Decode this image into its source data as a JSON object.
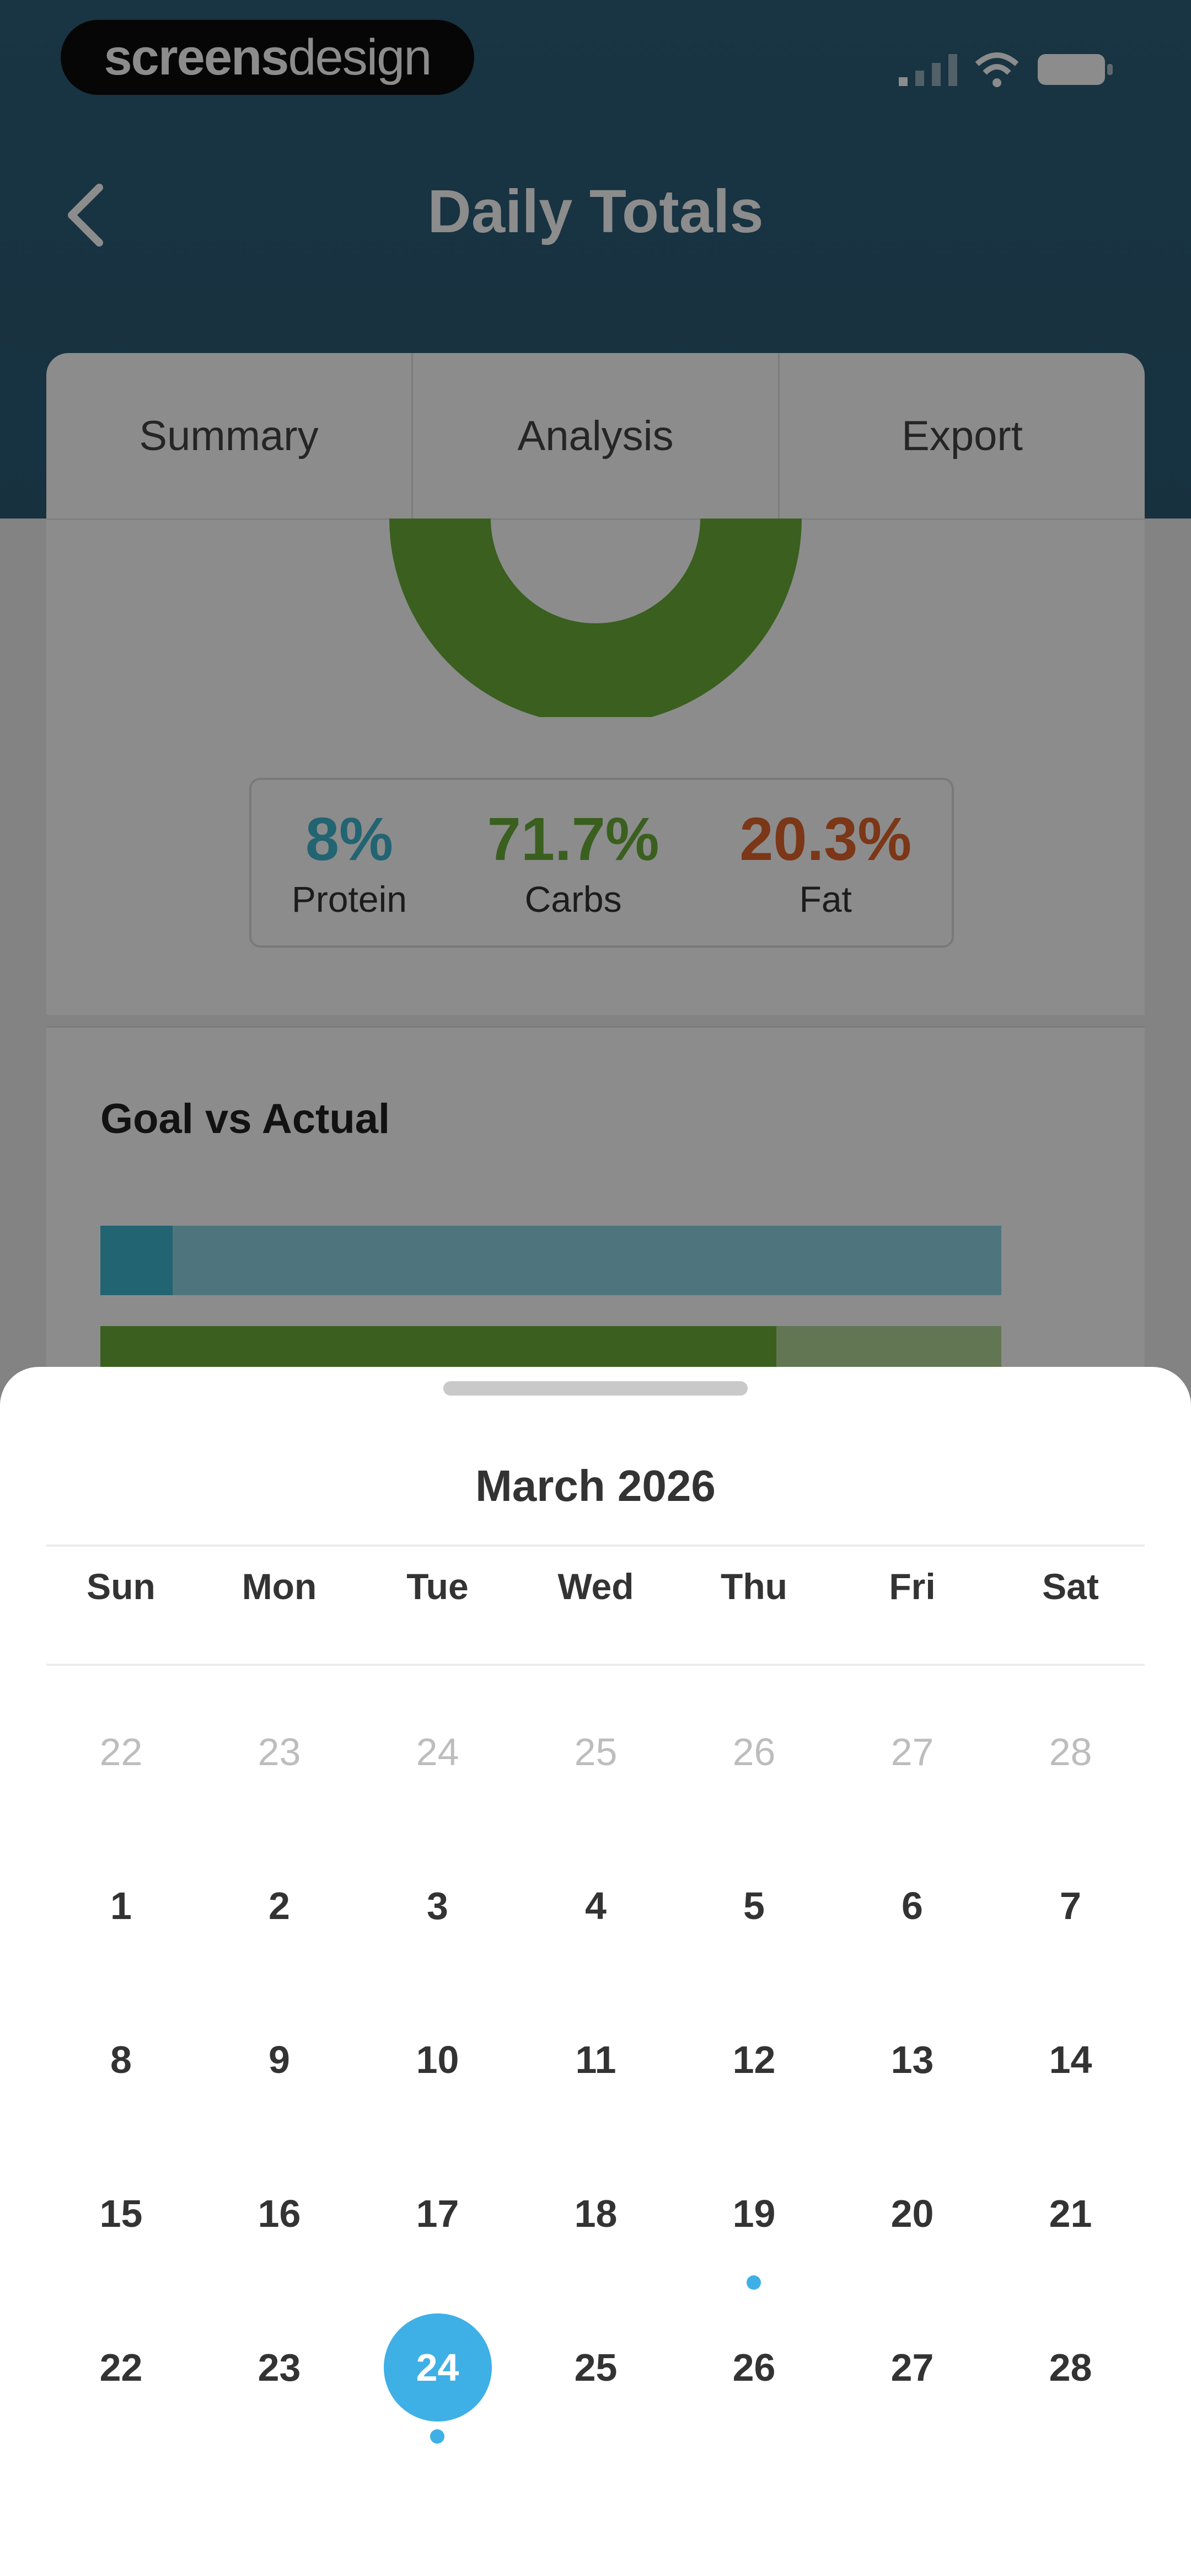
{
  "status_bar": {
    "brand_bold": "screens",
    "brand_light": "design"
  },
  "nav": {
    "title": "Daily Totals"
  },
  "tabs": [
    {
      "label": "Summary"
    },
    {
      "label": "Analysis"
    },
    {
      "label": "Export"
    }
  ],
  "macros": [
    {
      "pct": "8%",
      "label": "Protein",
      "color": "#3fb6cf"
    },
    {
      "pct": "71.7%",
      "label": "Carbs",
      "color": "#6aad3a"
    },
    {
      "pct": "20.3%",
      "label": "Fat",
      "color": "#e0642b"
    }
  ],
  "goal": {
    "title": "Goal vs Actual",
    "bars": [
      {
        "fraction": 0.08,
        "color": "#3fb6cf",
        "track": "#8fd6e3"
      },
      {
        "fraction": 0.75,
        "color": "#6aad3a",
        "track": "#b4d89a"
      }
    ]
  },
  "calendar": {
    "month_title": "March 2026",
    "weekdays": [
      "Sun",
      "Mon",
      "Tue",
      "Wed",
      "Thu",
      "Fri",
      "Sat"
    ],
    "weeks": [
      [
        {
          "n": "22",
          "m": true
        },
        {
          "n": "23",
          "m": true
        },
        {
          "n": "24",
          "m": true
        },
        {
          "n": "25",
          "m": true
        },
        {
          "n": "26",
          "m": true
        },
        {
          "n": "27",
          "m": true
        },
        {
          "n": "28",
          "m": true
        }
      ],
      [
        {
          "n": "1"
        },
        {
          "n": "2"
        },
        {
          "n": "3"
        },
        {
          "n": "4"
        },
        {
          "n": "5"
        },
        {
          "n": "6"
        },
        {
          "n": "7"
        }
      ],
      [
        {
          "n": "8"
        },
        {
          "n": "9"
        },
        {
          "n": "10"
        },
        {
          "n": "11"
        },
        {
          "n": "12"
        },
        {
          "n": "13"
        },
        {
          "n": "14"
        }
      ],
      [
        {
          "n": "15"
        },
        {
          "n": "16"
        },
        {
          "n": "17"
        },
        {
          "n": "18"
        },
        {
          "n": "19",
          "dot": true
        },
        {
          "n": "20"
        },
        {
          "n": "21"
        }
      ],
      [
        {
          "n": "22"
        },
        {
          "n": "23"
        },
        {
          "n": "24",
          "selected": true,
          "dot": true
        },
        {
          "n": "25"
        },
        {
          "n": "26"
        },
        {
          "n": "27"
        },
        {
          "n": "28"
        }
      ]
    ],
    "accent": "#3fb0e6"
  }
}
